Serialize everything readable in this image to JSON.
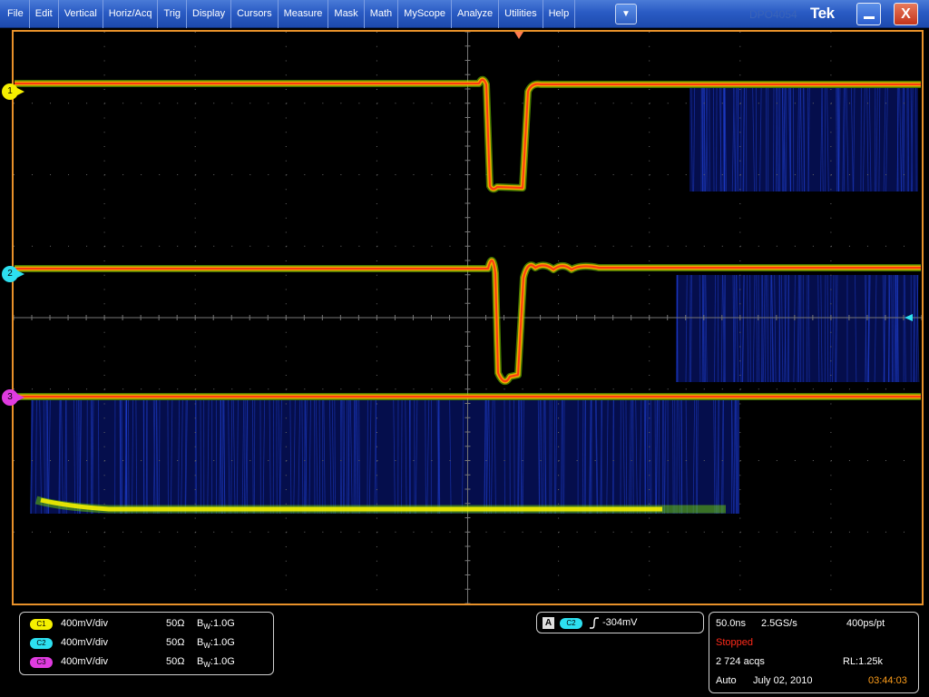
{
  "menu": {
    "items": [
      "File",
      "Edit",
      "Vertical",
      "Horiz/Acq",
      "Trig",
      "Display",
      "Cursors",
      "Measure",
      "Mask",
      "Math",
      "MyScope",
      "Analyze",
      "Utilities",
      "Help"
    ],
    "dropdown_icon": "chevron-down-icon",
    "brand": "Tek",
    "faint_text": "DPO4054"
  },
  "window_controls": {
    "minimize_icon": "minimize-icon",
    "close_icon": "close-icon",
    "close_glyph": "X"
  },
  "channel_markers": [
    {
      "label": "1",
      "color": "#f5f000"
    },
    {
      "label": "2",
      "color": "#2de0f0"
    },
    {
      "label": "3",
      "color": "#e03be0"
    }
  ],
  "channels": [
    {
      "badge": "C1",
      "scale": "400mV/div",
      "impedance": "50Ω",
      "bw_prefix": "B",
      "bw_sub": "W",
      "bw_value": ":1.0G",
      "color": "#f5f000"
    },
    {
      "badge": "C2",
      "scale": "400mV/div",
      "impedance": "50Ω",
      "bw_prefix": "B",
      "bw_sub": "W",
      "bw_value": ":1.0G",
      "color": "#2de0f0"
    },
    {
      "badge": "C3",
      "scale": "400mV/div",
      "impedance": "50Ω",
      "bw_prefix": "B",
      "bw_sub": "W",
      "bw_value": ":1.0G",
      "color": "#e03be0"
    }
  ],
  "trigger": {
    "mode": "A",
    "source": "C2",
    "slope_icon": "rising-edge-icon",
    "level": "-304mV"
  },
  "acquisition": {
    "timebase": "50.0ns",
    "sample_rate": "2.5GS/s",
    "resolution": "400ps/pt",
    "state": "Stopped",
    "acqs": "2 724 acqs",
    "record_length": "RL:1.25k",
    "run_mode": "Auto",
    "date": "July 02, 2010",
    "time": "03:44:03"
  },
  "colors": {
    "graticule_border": "#e8912a",
    "trace_hot": "#ff3a12",
    "trace_warm": "#ffb000",
    "trace_mid": "#7ee000",
    "persistence": "#0a1a8a",
    "accent_blue": "#2a5bc4"
  }
}
